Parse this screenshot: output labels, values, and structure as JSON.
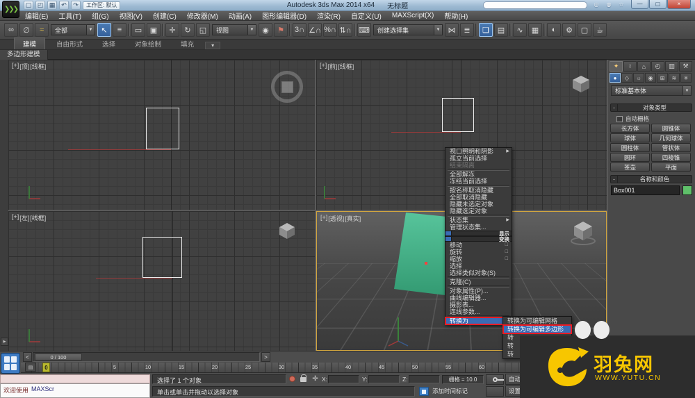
{
  "colors": {
    "accent_blue": "#3a6cb4",
    "annotation_red": "#ec1b23",
    "active_viewport_border": "#d2a63f",
    "box_fill": "#45b08a",
    "watermark_yellow": "#f7c600",
    "object_color": "#5fc06a"
  },
  "ui": {
    "dropdown_arrow": "▼",
    "collapse_glyph": "-"
  },
  "titlebar": {
    "title": "Autodesk 3ds Max  2014 x64",
    "document": "无标题",
    "search_value": "",
    "work_area_logo": "❯❯❯",
    "qat_icons": [
      {
        "name": "new-scene-icon",
        "glyph": "▢"
      },
      {
        "name": "open-file-icon",
        "glyph": "◰"
      },
      {
        "name": "save-file-icon",
        "glyph": "▦"
      },
      {
        "name": "undo-icon",
        "glyph": "↶"
      },
      {
        "name": "redo-icon",
        "glyph": "↷"
      }
    ],
    "workspace_dropdown": "工作区: 默认",
    "infocenter_icons": [
      {
        "name": "search-icon",
        "glyph": "◎"
      },
      {
        "name": "communication-center-icon",
        "glyph": "◍"
      },
      {
        "name": "favorites-icon",
        "glyph": "☆"
      },
      {
        "name": "help-icon",
        "glyph": "?"
      }
    ],
    "window_buttons": [
      {
        "name": "minimize-button",
        "glyph": "—"
      },
      {
        "name": "maximize-button",
        "glyph": "▢"
      },
      {
        "name": "close-button",
        "glyph": "×",
        "cls": "close"
      }
    ]
  },
  "menubar": {
    "items": [
      "编辑(E)",
      "工具(T)",
      "组(G)",
      "视图(V)",
      "创建(C)",
      "修改器(M)",
      "动画(A)",
      "图形编辑器(D)",
      "渲染(R)",
      "自定义(U)",
      "MAXScript(X)",
      "帮助(H)"
    ]
  },
  "toolbar": {
    "g1": [
      {
        "name": "select-and-link-icon",
        "glyph": "∞"
      },
      {
        "name": "unlink-selection-icon",
        "glyph": "∅"
      },
      {
        "name": "bind-to-space-warp-icon",
        "glyph": "≈",
        "cls": "gold"
      }
    ],
    "selection_filter": "全部",
    "g2": [
      {
        "name": "select-object-icon",
        "glyph": "↖",
        "cls": "active"
      },
      {
        "name": "select-by-name-icon",
        "glyph": "≡"
      },
      {
        "name": "toolbar-separator",
        "cls": "tsep"
      },
      {
        "name": "rectangular-selection-region-icon",
        "glyph": "▭"
      },
      {
        "name": "window-crossing-icon",
        "glyph": "▣"
      },
      {
        "name": "toolbar-separator",
        "cls": "tsep"
      },
      {
        "name": "select-and-move-icon",
        "glyph": "✛"
      },
      {
        "name": "select-and-rotate-icon",
        "glyph": "↻"
      },
      {
        "name": "select-and-scale-icon",
        "glyph": "◱"
      }
    ],
    "coordsys": "视图",
    "g3": [
      {
        "name": "use-pivot-center-icon",
        "glyph": "◉"
      },
      {
        "name": "select-and-manipulate-icon",
        "glyph": "⚑",
        "cls": "red"
      },
      {
        "name": "toolbar-separator",
        "cls": "tsep"
      },
      {
        "name": "snap-toggle-3d-icon",
        "glyph": "3∩"
      },
      {
        "name": "angle-snap-icon",
        "glyph": "∠∩"
      },
      {
        "name": "percent-snap-icon",
        "glyph": "%∩"
      },
      {
        "name": "spinner-snap-icon",
        "glyph": "⇅∩"
      },
      {
        "name": "toolbar-separator",
        "cls": "tsep"
      },
      {
        "name": "keyboard-shortcut-override-icon",
        "glyph": "⌨"
      }
    ],
    "named_selection": "创建选择集",
    "g4": [
      {
        "name": "mirror-icon",
        "glyph": "⋈"
      },
      {
        "name": "align-icon",
        "glyph": "≣"
      },
      {
        "name": "toolbar-separator",
        "cls": "tsep"
      },
      {
        "name": "layer-manager-icon",
        "glyph": "❏",
        "cls": "active"
      },
      {
        "name": "graphite-ribbon-toggle-icon",
        "glyph": "▤"
      },
      {
        "name": "toolbar-separator",
        "cls": "tsep"
      },
      {
        "name": "curve-editor-icon",
        "glyph": "∿"
      },
      {
        "name": "schematic-view-icon",
        "glyph": "▦"
      },
      {
        "name": "toolbar-separator",
        "cls": "tsep"
      },
      {
        "name": "material-editor-icon",
        "glyph": "◐"
      },
      {
        "name": "render-setup-icon",
        "glyph": "⚙"
      },
      {
        "name": "rendered-frame-window-icon",
        "glyph": "▢"
      },
      {
        "name": "render-production-icon",
        "glyph": "☕"
      }
    ]
  },
  "ribbon": {
    "tabs": [
      {
        "label": "建模",
        "cls": "active"
      },
      {
        "label": "自由形式"
      },
      {
        "label": "选择"
      },
      {
        "label": "对象绘制"
      },
      {
        "label": "填充"
      }
    ],
    "more_glyph": "▾",
    "subtab": "多边形建模"
  },
  "viewports": {
    "top": {
      "plus": "[+]",
      "name": "[顶]",
      "shading": "[线框]"
    },
    "front": {
      "plus": "[+]",
      "name": "[前]",
      "shading": "[线框]"
    },
    "left": {
      "plus": "[+]",
      "name": "[左]",
      "shading": "[线框]"
    },
    "perspective": {
      "plus": "[+]",
      "name": "[透视]",
      "shading": "[真实]"
    }
  },
  "quad_menu": {
    "display_header": "显示",
    "transform_header": "变换",
    "display_items": [
      {
        "label": "视口照明和阴影",
        "arrow": "▶"
      },
      {
        "label": "孤立当前选择"
      },
      {
        "label": "结束隔离",
        "cls": "disabled"
      },
      {
        "cls": "sep"
      },
      {
        "label": "全部解冻"
      },
      {
        "label": "冻结当前选择"
      },
      {
        "cls": "sep"
      },
      {
        "label": "按名称取消隐藏"
      },
      {
        "label": "全部取消隐藏"
      },
      {
        "label": "隐藏未选定对象"
      },
      {
        "label": "隐藏选定对象"
      },
      {
        "cls": "sep"
      },
      {
        "label": "状态集",
        "arrow": "▶"
      },
      {
        "label": "管理状态集..."
      }
    ],
    "transform_items": [
      {
        "label": "移动",
        "box": "□"
      },
      {
        "label": "旋转",
        "box": "□"
      },
      {
        "label": "缩放",
        "box": "□"
      },
      {
        "label": "选择"
      },
      {
        "label": "选择类似对象(S)"
      },
      {
        "cls": "sep"
      },
      {
        "label": "克隆(C)"
      },
      {
        "cls": "sep"
      },
      {
        "label": "对象属性(P)..."
      },
      {
        "label": "曲线编辑器..."
      },
      {
        "label": "摄影表..."
      },
      {
        "label": "连线参数..."
      },
      {
        "cls": "sep"
      },
      {
        "label": "转换为",
        "arrow": "▶",
        "cls": "highlight"
      }
    ],
    "submenu_items": [
      {
        "label": "转换为可编辑网格"
      },
      {
        "label": "转换为可编辑多边形",
        "cls": "highlight"
      },
      {
        "label": "转"
      },
      {
        "label": "转"
      },
      {
        "label": "转"
      }
    ]
  },
  "command_panel": {
    "tabs": [
      {
        "name": "create-tab-icon",
        "glyph": "✦",
        "cls": "active"
      },
      {
        "name": "modify-tab-icon",
        "glyph": "≀"
      },
      {
        "name": "hierarchy-tab-icon",
        "glyph": "⌂"
      },
      {
        "name": "motion-tab-icon",
        "glyph": "◴"
      },
      {
        "name": "display-tab-icon",
        "glyph": "▥"
      },
      {
        "name": "utilities-tab-icon",
        "glyph": "⚒"
      }
    ],
    "categories": [
      {
        "name": "geometry-icon",
        "glyph": "●",
        "cls": "active"
      },
      {
        "name": "shapes-icon",
        "glyph": "◇"
      },
      {
        "name": "lights-icon",
        "glyph": "☼"
      },
      {
        "name": "cameras-icon",
        "glyph": "◉"
      },
      {
        "name": "helpers-icon",
        "glyph": "⊞"
      },
      {
        "name": "space-warps-icon",
        "glyph": "≋"
      },
      {
        "name": "systems-icon",
        "glyph": "✳"
      }
    ],
    "category_dropdown": "标准基本体",
    "object_type_rollout": "对象类型",
    "autogrid_label": "自动栅格",
    "object_buttons": [
      "长方体",
      "圆锥体",
      "球体",
      "几何球体",
      "圆柱体",
      "管状体",
      "圆环",
      "四棱锥",
      "茶壶",
      "平面"
    ],
    "name_color_rollout": "名称和颜色",
    "object_name": "Box001"
  },
  "timeline": {
    "prev": "<",
    "next": ">",
    "slider_label": "0 / 100",
    "current_frame": "0",
    "tick_labels": [
      "5",
      "10",
      "15",
      "20",
      "25",
      "30",
      "35",
      "40",
      "45",
      "50",
      "55",
      "60"
    ]
  },
  "status_bar": {
    "welcome_prefix": "欢迎使用",
    "welcome_suffix": "MAXScr",
    "selection_status": "选择了 1 个对象",
    "prompt": "单击或单击并拖动以选择对象",
    "x_label": "X:",
    "y_label": "Y:",
    "z_label": "Z:",
    "x_value": "",
    "y_value": "",
    "z_value": "",
    "grid_readout": "栅格 = 10.0",
    "add_time_tag": "添加时间标记",
    "auto_key": "自动关键点",
    "set_key": "设置关键点"
  },
  "watermark": {
    "brand": "羽兔网",
    "url": "WWW.YUTU.CN"
  }
}
